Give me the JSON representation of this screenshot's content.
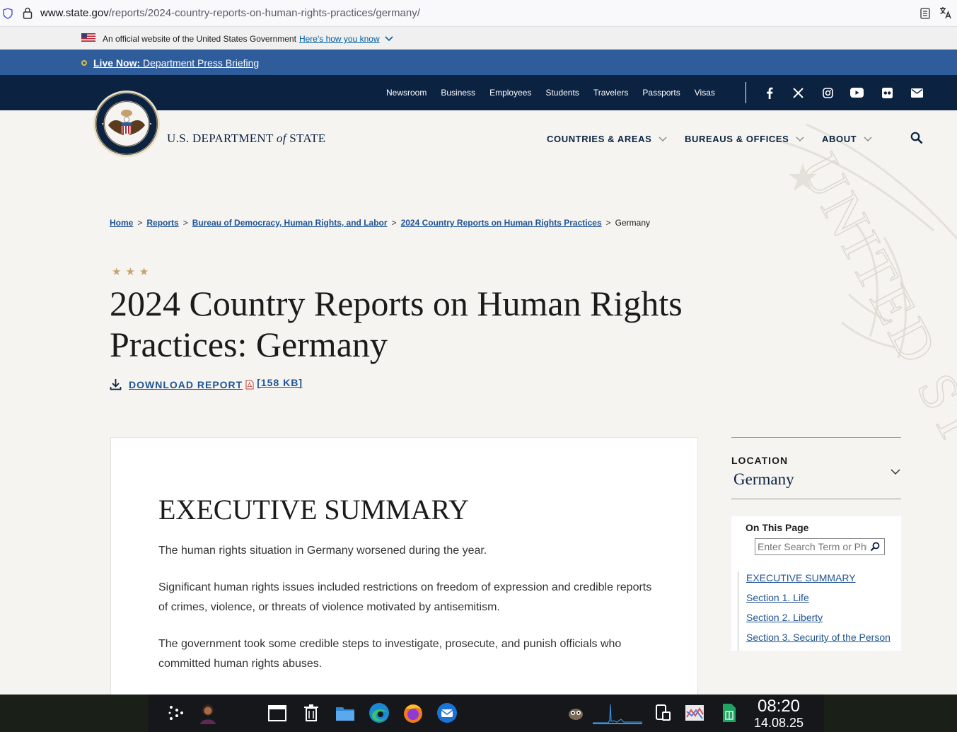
{
  "browser": {
    "url_domain": "www.state.gov",
    "url_path": "/reports/2024-country-reports-on-human-rights-practices/germany/"
  },
  "official_banner": {
    "text": "An official website of the United States Government",
    "link": "Here's how you know"
  },
  "live": {
    "label": "Live Now:",
    "text": " Department Press Briefing"
  },
  "topnav": {
    "links": [
      "Newsroom",
      "Business",
      "Employees",
      "Students",
      "Travelers",
      "Passports",
      "Visas"
    ],
    "social_icons": [
      "facebook-icon",
      "x-icon",
      "instagram-icon",
      "youtube-icon",
      "flickr-icon",
      "email-icon"
    ]
  },
  "header": {
    "dept_pre": "U.S. DEPARTMENT ",
    "dept_of": "of",
    "dept_post": " STATE",
    "nav": [
      "COUNTRIES & AREAS",
      "BUREAUS & OFFICES",
      "ABOUT"
    ]
  },
  "breadcrumb": {
    "items": [
      "Home",
      "Reports",
      "Bureau of Democracy, Human Rights, and Labor",
      "2024 Country Reports on Human Rights Practices"
    ],
    "current": "Germany",
    "separator": ">"
  },
  "page": {
    "stars": "★★★",
    "title": "2024 Country Reports on Human Rights Practices: Germany",
    "download_label": "DOWNLOAD REPORT",
    "download_size": "[158 KB]"
  },
  "content": {
    "heading": "EXECUTIVE SUMMARY",
    "paragraphs": [
      "The human rights situation in Germany worsened during the year.",
      "Significant human rights issues included restrictions on freedom of expression and credible reports of crimes, violence, or threats of violence motivated by antisemitism.",
      "The government took some credible steps to investigate, prosecute, and punish officials who committed human rights abuses."
    ]
  },
  "sidebar": {
    "location_label": "LOCATION",
    "location_value": "Germany",
    "on_this_page": "On This Page",
    "search_placeholder": "Enter Search Term or Phrase",
    "links": [
      "EXECUTIVE SUMMARY",
      "Section 1. Life",
      "Section 2. Liberty",
      "Section 3. Security of the Person"
    ]
  },
  "taskbar": {
    "time": "08:20",
    "date": "14.08.25"
  },
  "colors": {
    "navy": "#0b2240",
    "live_blue": "#2f5c9a",
    "link_blue": "#205493",
    "star_gold": "#c5a26d"
  }
}
